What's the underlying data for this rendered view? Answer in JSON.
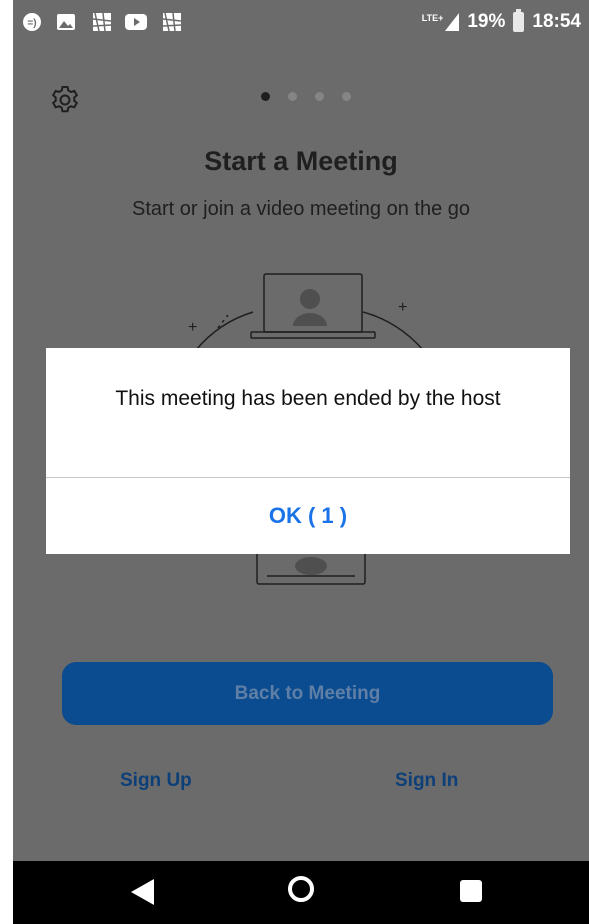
{
  "status_bar": {
    "network": "LTE+",
    "battery_percent": "19%",
    "time": "18:54",
    "left_icons": [
      "chat-bubble-icon",
      "image-icon",
      "app-icon",
      "youtube-icon",
      "app-icon"
    ]
  },
  "header": {
    "settings_icon": "gear-icon"
  },
  "carousel": {
    "page_count": 4,
    "active_index": 0,
    "title": "Start a Meeting",
    "subtitle": "Start or join a video meeting on the go"
  },
  "dialog": {
    "message": "This meeting has been ended by the host",
    "ok_label": "OK ( 1 )"
  },
  "actions": {
    "back_to_meeting": "Back to Meeting",
    "sign_up": "Sign Up",
    "sign_in": "Sign In"
  },
  "nav_bar": {
    "back_icon": "back-triangle-icon",
    "home_icon": "home-circle-icon",
    "recents_icon": "recents-square-icon"
  },
  "colors": {
    "dim_background": "#6b6b6b",
    "primary_blue": "#1a73e8",
    "button_dimmed": "#0b4b8f",
    "link_dimmed": "#0d3f78"
  }
}
